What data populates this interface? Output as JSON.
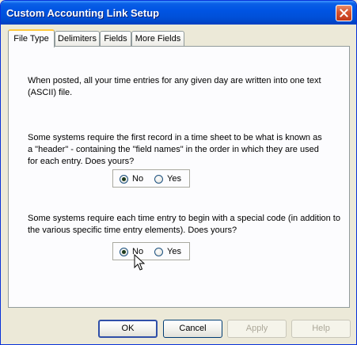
{
  "window": {
    "title": "Custom Accounting Link Setup"
  },
  "tabs": [
    {
      "label": "File Type",
      "active": true
    },
    {
      "label": "Delimiters",
      "active": false
    },
    {
      "label": "Fields",
      "active": false
    },
    {
      "label": "More Fields",
      "active": false
    }
  ],
  "panel": {
    "intro": "When posted, all your time entries for any given day are written into one text (ASCII) file.",
    "header_question": "Some systems require the first record in a time sheet to be what is known as a \"header\" - containing the \"field names\" in the order in which they are used for each entry. Does yours?",
    "header_options": {
      "no": "No",
      "yes": "Yes",
      "selected": "No"
    },
    "code_question": "Some systems require each time entry to begin with a special code (in addition to the various specific time entry elements). Does yours?",
    "code_options": {
      "no": "No",
      "yes": "Yes",
      "selected": "No"
    }
  },
  "buttons": {
    "ok": "OK",
    "cancel": "Cancel",
    "apply": "Apply",
    "help": "Help"
  },
  "icons": {
    "close": "close-icon",
    "cursor": "mouse-pointer-icon"
  }
}
